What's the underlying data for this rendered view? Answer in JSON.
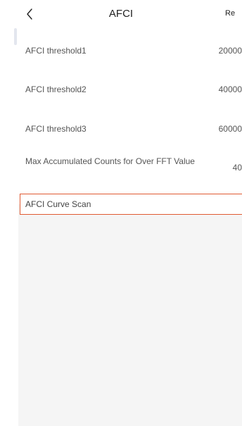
{
  "header": {
    "title": "AFCI",
    "right_action": "Re"
  },
  "settings": {
    "rows": [
      {
        "label": "AFCI threshold1",
        "value": "20000"
      },
      {
        "label": "AFCI threshold2",
        "value": "40000"
      },
      {
        "label": "AFCI threshold3",
        "value": "60000"
      },
      {
        "label": "Max Accumulated Counts for Over FFT Value",
        "value": "40"
      }
    ],
    "curve_scan_label": "AFCI Curve Scan"
  },
  "colors": {
    "highlight_border": "#e05a32",
    "panel_background": "#f5f5f5"
  },
  "icons": {
    "back": "chevron-left-icon"
  }
}
